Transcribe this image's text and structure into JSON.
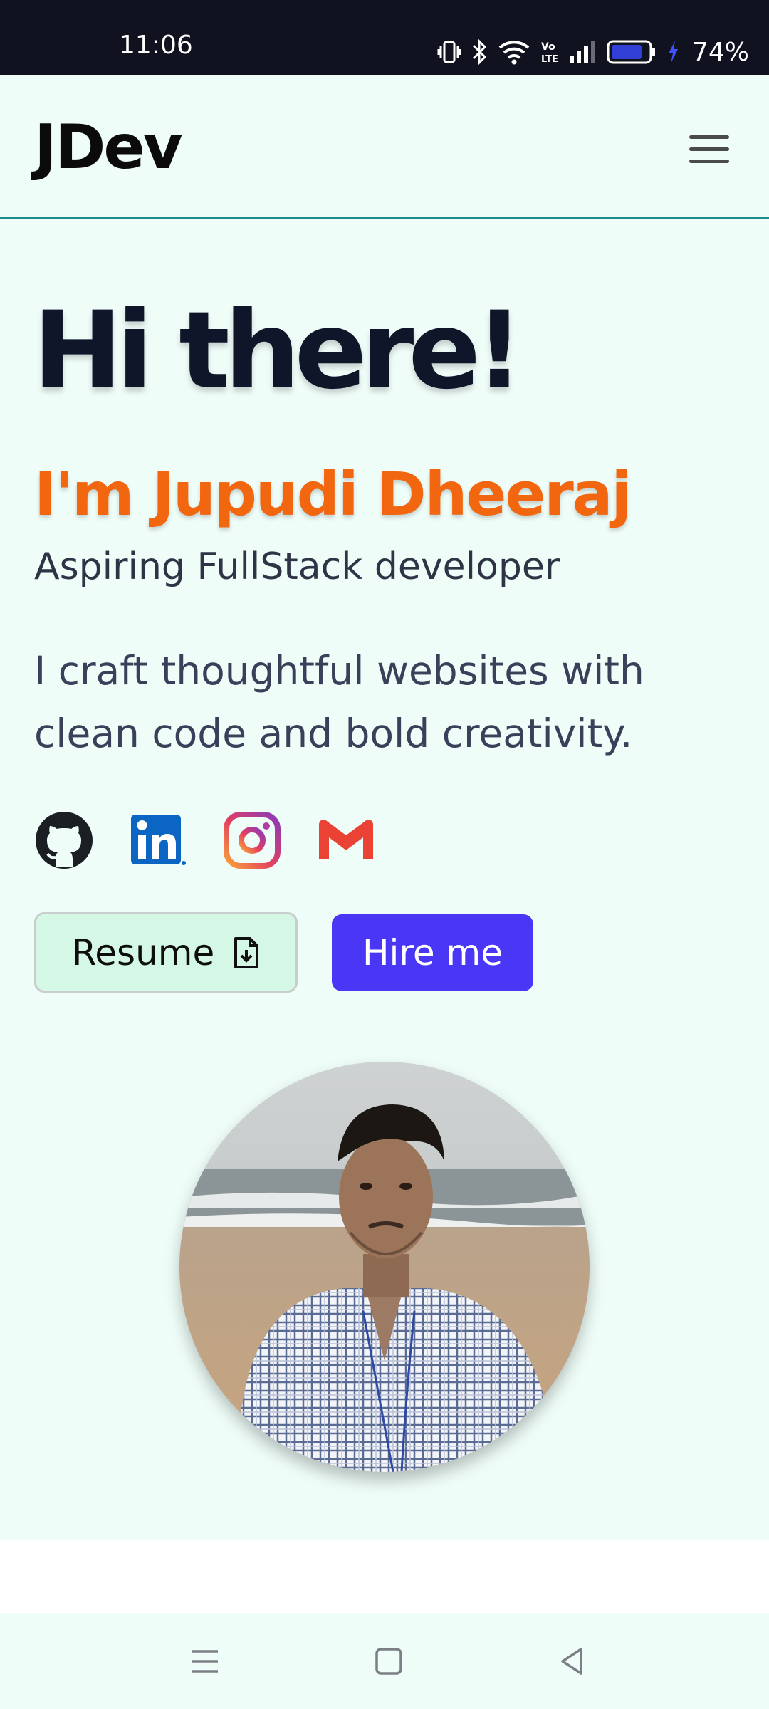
{
  "status_bar": {
    "time": "11:06",
    "battery_percent": "74%",
    "icons": [
      "vibrate-icon",
      "bluetooth-icon",
      "wifi-icon",
      "volte-icon",
      "signal-icon",
      "battery-icon",
      "charging-icon"
    ]
  },
  "header": {
    "logo": "JDev",
    "menu_icon": "hamburger-menu-icon"
  },
  "hero": {
    "greeting": "Hi there!",
    "name_line": "I'm Jupudi Dheeraj",
    "role": "Aspiring FullStack developer",
    "tagline": "I craft thoughtful websites with clean code and bold creativity."
  },
  "social_links": [
    {
      "name": "GitHub",
      "icon": "github-icon"
    },
    {
      "name": "LinkedIn",
      "icon": "linkedin-icon"
    },
    {
      "name": "Instagram",
      "icon": "instagram-icon"
    },
    {
      "name": "Gmail",
      "icon": "gmail-icon"
    }
  ],
  "buttons": {
    "resume_label": "Resume",
    "hire_label": "Hire me"
  },
  "colors": {
    "background": "#effdf9",
    "accent_orange": "#f2660f",
    "hire_button": "#4a36f5",
    "resume_button": "#d5f8e6",
    "heading": "#0f1629"
  },
  "nav_bar": {
    "icons": [
      "menu-nav-icon",
      "home-nav-icon",
      "back-nav-icon"
    ]
  }
}
